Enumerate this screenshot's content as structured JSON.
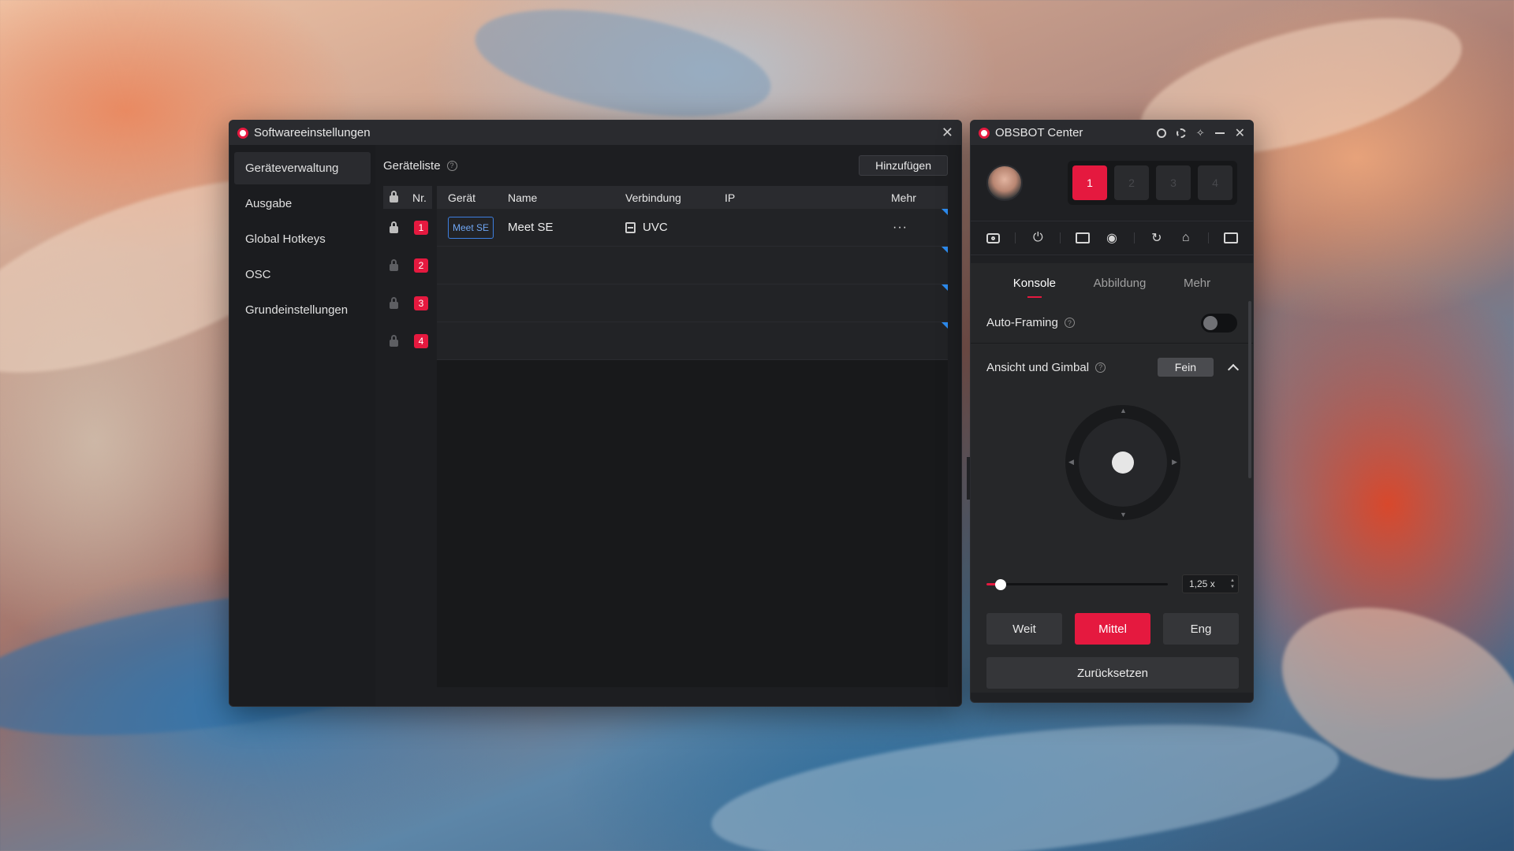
{
  "settings_window": {
    "title": "Softwareeinstellungen",
    "nav": [
      "Geräteverwaltung",
      "Ausgabe",
      "Global Hotkeys",
      "OSC",
      "Grundeinstellungen"
    ],
    "list_title": "Geräteliste",
    "add_button": "Hinzufügen",
    "columns": {
      "nr": "Nr.",
      "device": "Gerät",
      "name": "Name",
      "connection": "Verbindung",
      "ip": "IP",
      "more": "Mehr"
    },
    "rows": [
      {
        "nr": "1",
        "device": "Meet SE",
        "name": "Meet SE",
        "connection": "UVC",
        "more": "···"
      },
      {
        "nr": "2"
      },
      {
        "nr": "3"
      },
      {
        "nr": "4"
      }
    ]
  },
  "obsbot_window": {
    "title": "OBSBOT Center",
    "slots": [
      "1",
      "2",
      "3",
      "4"
    ],
    "tabs": [
      "Konsole",
      "Abbildung",
      "Mehr"
    ],
    "auto_framing_label": "Auto-Framing",
    "auto_framing_on": false,
    "gimbal_label": "Ansicht und Gimbal",
    "precision_button": "Fein",
    "zoom_value": "1,25 x",
    "zoom_fraction": 0.08,
    "modes": [
      "Weit",
      "Mittel",
      "Eng"
    ],
    "active_mode": "Mittel",
    "reset_button": "Zurücksetzen",
    "accent_color": "#e5193f"
  }
}
